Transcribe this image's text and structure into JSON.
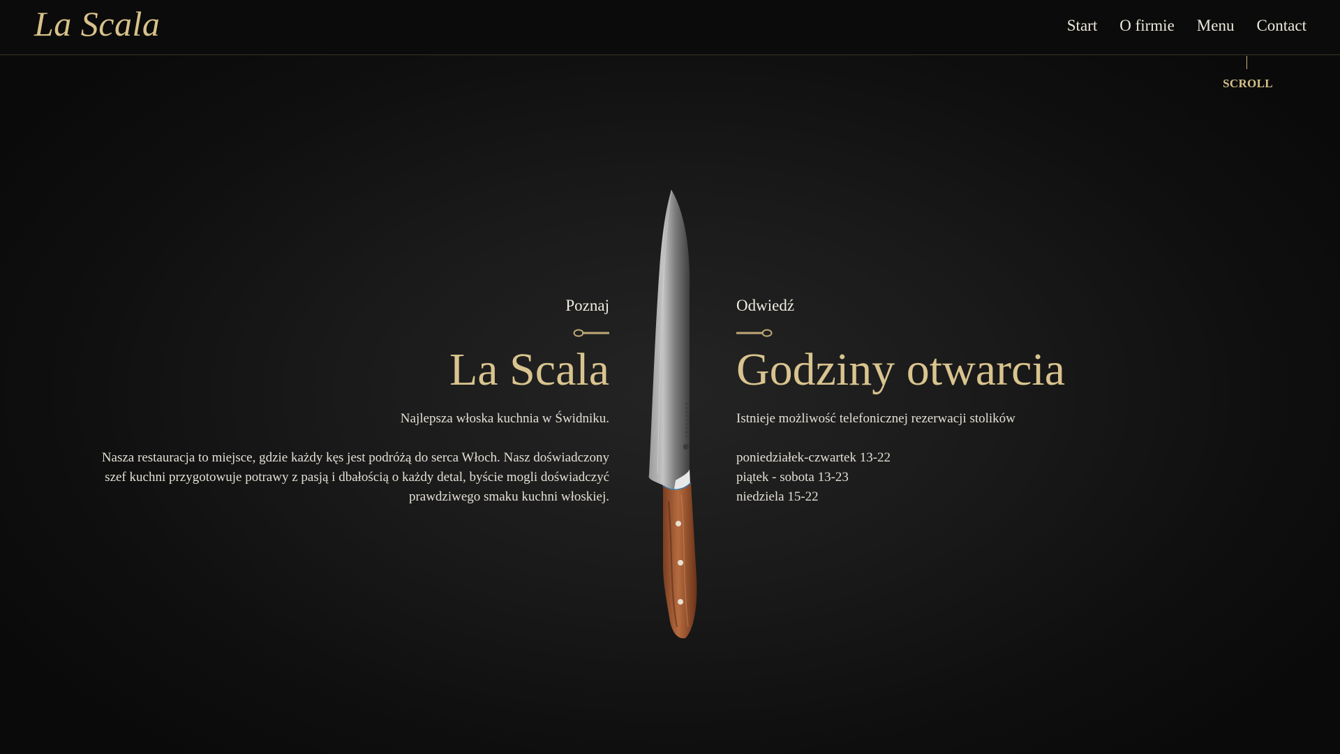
{
  "header": {
    "logo": "La Scala",
    "nav": [
      {
        "label": "Start"
      },
      {
        "label": "O firmie"
      },
      {
        "label": "Menu"
      },
      {
        "label": "Contact"
      }
    ]
  },
  "scroll": {
    "label": "SCROLL"
  },
  "left": {
    "eyebrow": "Poznaj",
    "title": "La Scala",
    "lead": "Najlepsza włoska kuchnia w Świdniku.",
    "description_lines": [
      "Nasza restauracja to miejsce, gdzie każdy kęs jest podróżą do serca Włoch. Nasz doświadczony",
      "szef kuchni przygotowuje potrawy z pasją i dbałością o każdy detal, byście mogli doświadczyć",
      "prawdziwego smaku kuchni włoskiej."
    ]
  },
  "right": {
    "eyebrow": "Odwiedź",
    "title": "Godziny otwarcia",
    "lead": "Istnieje możliwość telefonicznej rezerwacji stolików",
    "hours": [
      "poniedziałek-czwartek 13-22",
      "piątek - sobota 13-23",
      "niedziela 15-22"
    ]
  },
  "knife": {
    "brand": "SAVERNAKE"
  },
  "colors": {
    "gold": "#d9c48f",
    "background": "#0b0b0b",
    "text": "#e6e2d8"
  }
}
